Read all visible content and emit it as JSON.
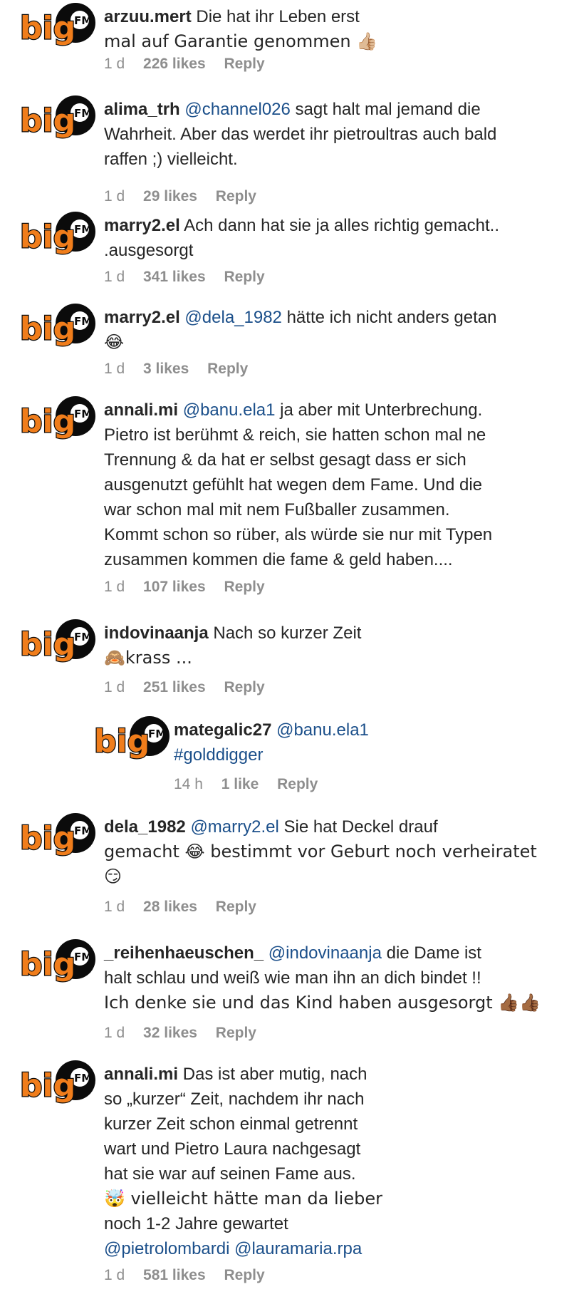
{
  "colors": {
    "text": "#262626",
    "meta": "#8e8e8e",
    "mention": "#1b4f8a",
    "logo_orange": "#f07d1b"
  },
  "logo": {
    "word": "big",
    "badge": "FM"
  },
  "comments": [
    {
      "user": "arzuu.mert",
      "mention": "",
      "text_lines": [
        "Die hat ihr Leben erst",
        "mal auf Garantie genommen 👍🏼"
      ],
      "time": "1 d",
      "likes": "226 likes",
      "reply": "Reply"
    },
    {
      "user": "alima_trh",
      "mention": "@channel026",
      "text_lines": [
        "sagt halt mal jemand die",
        "Wahrheit. Aber das werdet ihr pietroultras auch bald",
        "raffen ;) vielleicht."
      ],
      "time": "1 d",
      "likes": "29 likes",
      "reply": "Reply"
    },
    {
      "user": "marry2.el",
      "mention": "",
      "text_lines": [
        "Ach dann hat sie ja alles richtig gemacht..",
        ".ausgesorgt"
      ],
      "time": "1 d",
      "likes": "341 likes",
      "reply": "Reply"
    },
    {
      "user": "marry2.el",
      "mention": "@dela_1982",
      "text_lines": [
        "hätte ich nicht anders getan",
        "😂"
      ],
      "time": "1 d",
      "likes": "3 likes",
      "reply": "Reply"
    },
    {
      "user": "annali.mi",
      "mention": "@banu.ela1",
      "text_lines": [
        "ja aber mit Unterbrechung.",
        "Pietro ist berühmt & reich, sie hatten schon mal ne",
        "Trennung & da hat er selbst gesagt dass er sich",
        "ausgenutzt gefühlt hat wegen dem Fame. Und die",
        "war schon mal mit nem Fußballer zusammen.",
        "Kommt schon so rüber, als würde sie nur mit Typen",
        "zusammen kommen die fame & geld haben...."
      ],
      "time": "1 d",
      "likes": "107 likes",
      "reply": "Reply"
    },
    {
      "user": "indovinaanja",
      "mention": "",
      "text_lines": [
        "Nach so kurzer Zeit",
        "🙈krass ..."
      ],
      "time": "1 d",
      "likes": "251 likes",
      "reply": "Reply"
    },
    {
      "user": "mategalic27",
      "mention": "@banu.ela1",
      "text_lines": [
        "",
        "#golddigger"
      ],
      "time": "14 h",
      "likes": "1 like",
      "reply": "Reply"
    },
    {
      "user": "dela_1982",
      "mention": "@marry2.el",
      "text_lines": [
        "Sie hat Deckel drauf",
        "gemacht 😂 bestimmt vor Geburt noch verheiratet",
        "😏"
      ],
      "time": "1 d",
      "likes": "28 likes",
      "reply": "Reply"
    },
    {
      "user": "_reihenhaeuschen_",
      "mention": "@indovinaanja",
      "text_lines": [
        "die Dame ist",
        "halt schlau und weiß wie man ihn an dich bindet !!",
        "Ich denke sie und das Kind haben ausgesorgt 👍🏾👍🏾"
      ],
      "time": "1 d",
      "likes": "32 likes",
      "reply": "Reply"
    },
    {
      "user": "annali.mi",
      "mention": "",
      "text_lines": [
        "Das ist aber mutig, nach",
        "so „kurzer“ Zeit, nachdem ihr nach",
        "kurzer Zeit schon einmal getrennt",
        "wart und Pietro Laura nachgesagt",
        "hat sie war auf seinen Fame aus.",
        "🤯 vielleicht hätte man da lieber",
        "noch 1-2 Jahre gewartet"
      ],
      "mention_lines": [
        "@pietrolombardi @lauramaria.rpa"
      ],
      "time": "1 d",
      "likes": "581 likes",
      "reply": "Reply"
    }
  ]
}
